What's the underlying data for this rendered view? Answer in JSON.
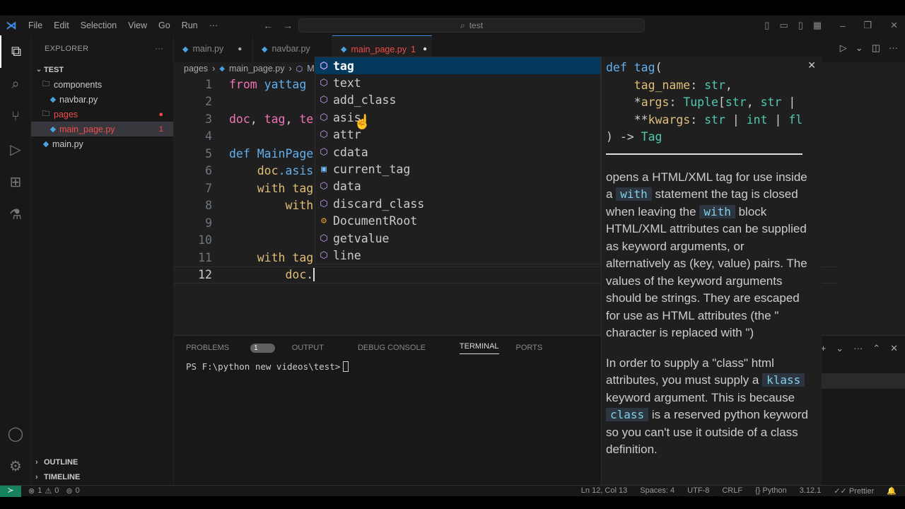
{
  "titlebar": {
    "menu": [
      "File",
      "Edit",
      "Selection",
      "View",
      "Go",
      "Run",
      "···"
    ],
    "search": "test"
  },
  "sidebar": {
    "header": "EXPLORER",
    "root": "TEST",
    "items": [
      {
        "label": "components",
        "type": "folder"
      },
      {
        "label": "navbar.py",
        "type": "file"
      },
      {
        "label": "pages",
        "type": "folder"
      },
      {
        "label": "main_page.py",
        "type": "file",
        "problems": "1"
      },
      {
        "label": "main.py",
        "type": "file"
      }
    ],
    "outline": "OUTLINE",
    "timeline": "TIMELINE"
  },
  "tabs": [
    {
      "label": "main.py"
    },
    {
      "label": "navbar.py"
    },
    {
      "label": "main_page.py",
      "problems": "1"
    }
  ],
  "breadcrumb": {
    "folder": "pages",
    "file": "main_page.py",
    "symbol": "M"
  },
  "editor": {
    "line_numbers": [
      "1",
      "2",
      "3",
      "4",
      "5",
      "6",
      "7",
      "8",
      "9",
      "10",
      "11",
      "12"
    ],
    "l1": {
      "a": "from ",
      "b": "yattag"
    },
    "l3": {
      "a": "doc",
      "b": ", ",
      "c": "tag",
      "d": ", ",
      "e": "te"
    },
    "l5": {
      "a": "def ",
      "b": "MainPage"
    },
    "l6": {
      "a": "doc",
      "b": ".asis"
    },
    "l7": {
      "a": "with ",
      "b": "tag"
    },
    "l8": {
      "a": "with"
    },
    "l11": {
      "a": "with ",
      "b": "tag"
    },
    "l12": {
      "a": "doc",
      "b": "."
    }
  },
  "suggestions": [
    {
      "label": "tag",
      "kind": "method"
    },
    {
      "label": "text",
      "kind": "method"
    },
    {
      "label": "add_class",
      "kind": "method"
    },
    {
      "label": "asis",
      "kind": "method"
    },
    {
      "label": "attr",
      "kind": "method"
    },
    {
      "label": "cdata",
      "kind": "method"
    },
    {
      "label": "current_tag",
      "kind": "field"
    },
    {
      "label": "data",
      "kind": "method"
    },
    {
      "label": "discard_class",
      "kind": "method"
    },
    {
      "label": "DocumentRoot",
      "kind": "class"
    },
    {
      "label": "getvalue",
      "kind": "method"
    },
    {
      "label": "line",
      "kind": "method"
    }
  ],
  "hover": {
    "sig1": {
      "a": "def ",
      "b": "tag",
      "c": "("
    },
    "sig2": {
      "a": "tag_name",
      "b": ": ",
      "c": "str",
      "d": ","
    },
    "sig3": {
      "a": "*",
      "b": "args",
      "c": ": ",
      "d": "Tuple",
      "e": "[",
      "f": "str",
      "g": ", ",
      "h": "str",
      "i": " |"
    },
    "sig4": {
      "a": "**",
      "b": "kwargs",
      "c": ": ",
      "d": "str",
      "e": " | ",
      "f": "int",
      "g": " | ",
      "h": "fl"
    },
    "sig5": {
      "a": ") -> ",
      "b": "Tag"
    },
    "p1a": "opens a HTML/XML tag for use inside a ",
    "p1code1": "with",
    "p1b": " statement the tag is closed when leaving the ",
    "p1code2": "with",
    "p1c": " block HTML/XML attributes can be supplied as keyword arguments, or alternatively as (key, value) pairs. The values of the keyword arguments should be strings. They are escaped for use as HTML attributes (the \" character is replaced with \")",
    "p2a": "In order to supply a \"class\" html attributes, you must supply a ",
    "p2code1": "klass",
    "p2b": " keyword argument. This is because ",
    "p2code2": "class",
    "p2c": " is a reserved python keyword so you can't use it outside of a class definition."
  },
  "panel": {
    "tabs": [
      "PROBLEMS",
      "OUTPUT",
      "DEBUG CONSOLE",
      "TERMINAL",
      "PORTS"
    ],
    "problems_count": "1",
    "prompt": "PS F:\\python new videos\\test>"
  },
  "statusbar": {
    "errors": "1",
    "warnings": "0",
    "ports": "0",
    "position": "Ln 12, Col 13",
    "spaces": "Spaces: 4",
    "encoding": "UTF-8",
    "eol": "CRLF",
    "language": "Python",
    "version": "3.12.1",
    "formatter": "Prettier"
  }
}
